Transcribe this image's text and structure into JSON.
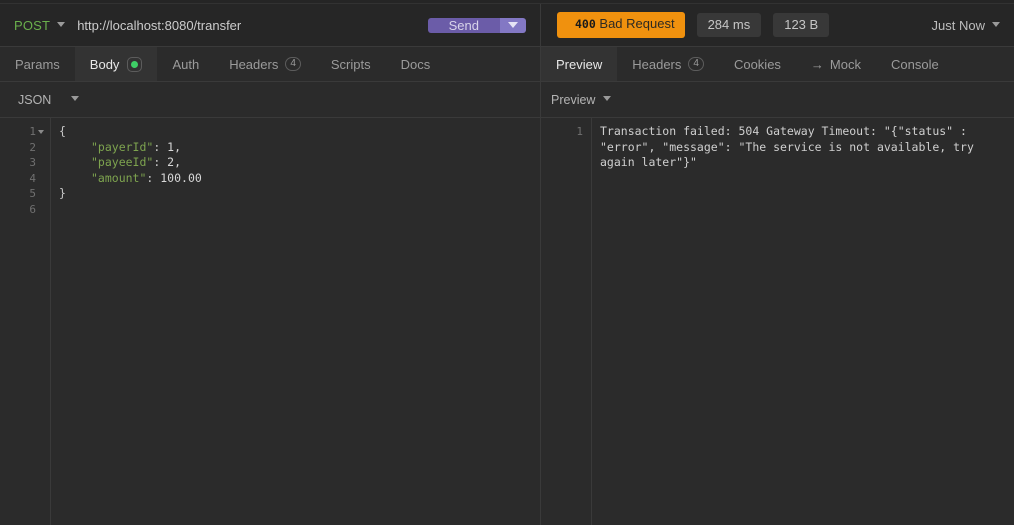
{
  "request": {
    "method": "POST",
    "url": "http://localhost:8080/transfer",
    "send_label": "Send",
    "send_dropdown_icon": "chevron-down-icon",
    "method_dropdown_icon": "chevron-down-icon"
  },
  "response_status": {
    "code": "400",
    "text": "Bad Request",
    "time": "284 ms",
    "size": "123 B",
    "timestamp": "Just Now",
    "timestamp_icon": "chevron-down-icon",
    "status_color": "#f0910e"
  },
  "request_tabs": [
    {
      "label": "Params",
      "active": false
    },
    {
      "label": "Body",
      "active": true,
      "dot": true,
      "dot_color": "#3ecf66"
    },
    {
      "label": "Auth",
      "active": false
    },
    {
      "label": "Headers",
      "active": false,
      "count": "4"
    },
    {
      "label": "Scripts",
      "active": false
    },
    {
      "label": "Docs",
      "active": false
    }
  ],
  "response_tabs": [
    {
      "label": "Preview",
      "active": true
    },
    {
      "label": "Headers",
      "active": false,
      "count": "4"
    },
    {
      "label": "Cookies",
      "active": false
    },
    {
      "label": "Mock",
      "active": false,
      "icon": "arrow-right-icon"
    },
    {
      "label": "Console",
      "active": false
    }
  ],
  "body_editor": {
    "format_label": "JSON",
    "format_icon": "chevron-down-icon",
    "line_numbers": [
      "1",
      "2",
      "3",
      "4",
      "5",
      "6"
    ],
    "lines": [
      {
        "punct": "{"
      },
      {
        "indent": "    ",
        "key": "\"payerId\"",
        "sep": ": ",
        "value": "1,"
      },
      {
        "indent": "    ",
        "key": "\"payeeId\"",
        "sep": ": ",
        "value": "2,"
      },
      {
        "indent": "    ",
        "key": "\"amount\"",
        "sep": ": ",
        "value": "100.00"
      },
      {
        "punct": "}"
      },
      {
        "punct": ""
      }
    ]
  },
  "response_preview": {
    "mode_label": "Preview",
    "mode_icon": "chevron-down-icon",
    "line_numbers": [
      "1"
    ],
    "text": "Transaction failed: 504 Gateway Timeout: \"{\"status\" : \"error\", \"message\": \"The service is not available, try again later\"}\""
  }
}
